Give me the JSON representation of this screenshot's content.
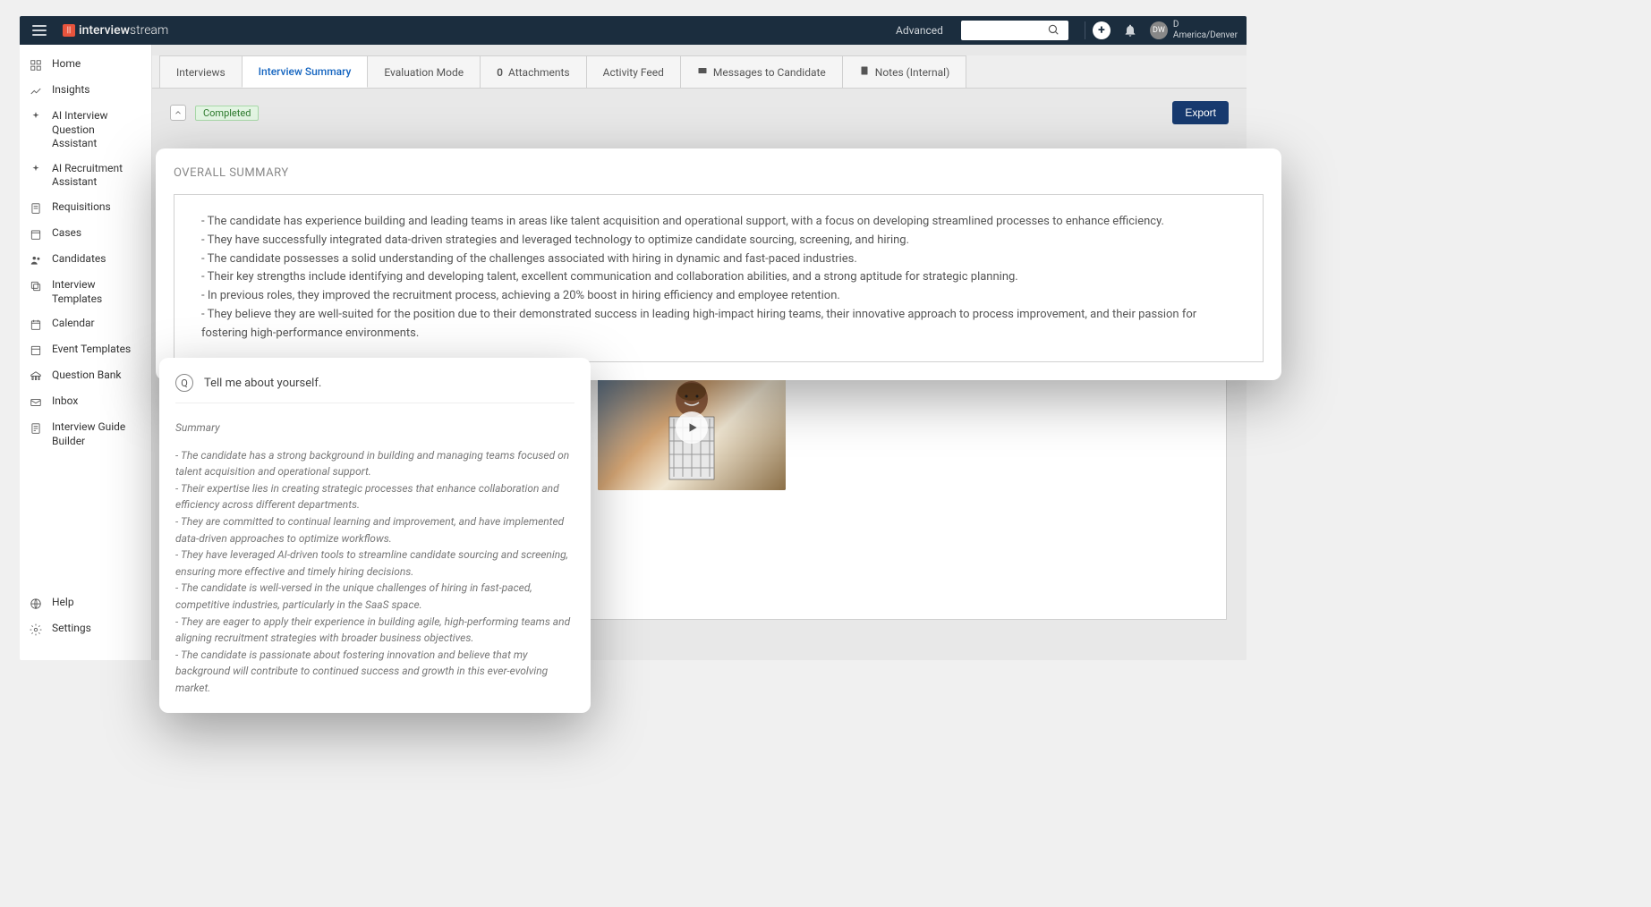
{
  "topbar": {
    "brand_prefix": "interview",
    "brand_suffix": "stream",
    "advanced": "Advanced",
    "search_placeholder": "",
    "user_initials": "DW",
    "user_letter": "D",
    "user_tz": "America/Denver"
  },
  "sidebar": {
    "items": [
      {
        "label": "Home"
      },
      {
        "label": "Insights"
      },
      {
        "label": "AI Interview Question Assistant"
      },
      {
        "label": "AI Recruitment Assistant"
      },
      {
        "label": "Requisitions"
      },
      {
        "label": "Cases"
      },
      {
        "label": "Candidates"
      },
      {
        "label": "Interview Templates"
      },
      {
        "label": "Calendar"
      },
      {
        "label": "Event Templates"
      },
      {
        "label": "Question Bank"
      },
      {
        "label": "Inbox"
      },
      {
        "label": "Interview Guide Builder"
      }
    ],
    "bottom": [
      {
        "label": "Help"
      },
      {
        "label": "Settings"
      }
    ]
  },
  "tabs": [
    {
      "label": "Interviews"
    },
    {
      "label": "Interview Summary",
      "active": true
    },
    {
      "label": "Evaluation Mode"
    },
    {
      "count": "0",
      "label": "Attachments"
    },
    {
      "label": "Activity Feed"
    },
    {
      "label": "Messages to Candidate",
      "icon": "msg"
    },
    {
      "label": "Notes (Internal)",
      "icon": "note"
    }
  ],
  "summary": {
    "status": "Completed",
    "export": "Export",
    "overall_title": "OVERALL SUMMARY",
    "overall_points": [
      "- The candidate has experience building and leading teams in areas like talent acquisition and operational support, with a focus on developing streamlined processes to enhance efficiency.",
      "- They have successfully integrated data-driven strategies and leveraged technology to optimize candidate sourcing, screening, and hiring.",
      "- The candidate possesses a solid understanding of the challenges associated with hiring in dynamic and fast-paced industries.",
      "- Their key strengths include identifying and developing talent, excellent communication and collaboration abilities, and a strong aptitude for strategic planning.",
      "- In previous roles, they improved the recruitment process, achieving a 20% boost in hiring efficiency and employee retention.",
      "- They believe they are well-suited for the position due to their demonstrated success in leading high-impact hiring teams, their innovative approach to process improvement, and their passion for fostering high-performance environments."
    ]
  },
  "question": {
    "badge": "Q",
    "title": "Tell me about yourself.",
    "summary_label": "Summary",
    "points": [
      "- The candidate has a strong background in building and managing teams focused on talent acquisition and operational support.",
      "- Their expertise lies in creating strategic processes that enhance collaboration and efficiency across different departments.",
      "- They are committed to continual learning and improvement, and have implemented data-driven approaches to optimize workflows.",
      "- They have leveraged AI-driven tools to streamline candidate sourcing and screening, ensuring more effective and timely hiring decisions.",
      "- The candidate is well-versed in the unique challenges of hiring in fast-paced, competitive industries, particularly in the SaaS space.",
      "- They are eager to apply their experience in building agile, high-performing teams and aligning recruitment strategies with broader business objectives.",
      "- The candidate is passionate about fostering innovation and believe that my background will contribute to continued success and growth in this ever-evolving market."
    ]
  }
}
